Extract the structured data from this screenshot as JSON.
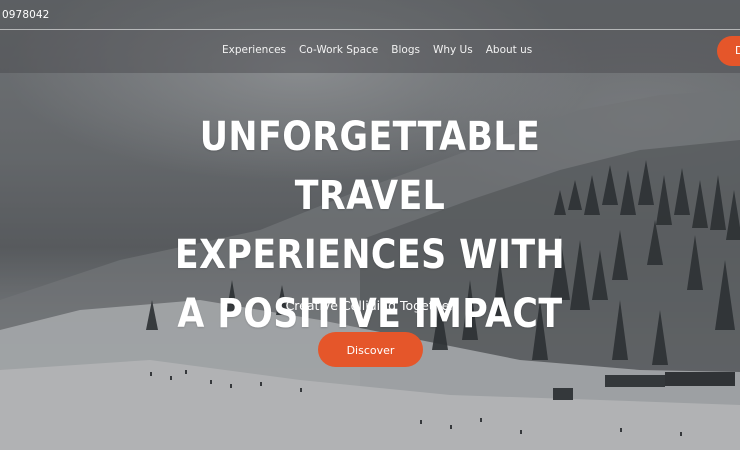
{
  "topbar": {
    "phone": "0978042"
  },
  "nav": {
    "items": [
      {
        "label": "Experiences"
      },
      {
        "label": "Co-Work Space"
      },
      {
        "label": "Blogs"
      },
      {
        "label": "Why Us"
      },
      {
        "label": "About us"
      }
    ],
    "cta_label": "D"
  },
  "hero": {
    "title_lines": [
      "Unforgettable Travel",
      "Experiences with",
      "A Positive Impact"
    ],
    "subtitle": "Creative Colliding Together",
    "button_label": "Discover"
  },
  "colors": {
    "accent": "#e5562a",
    "text": "#ffffff"
  }
}
